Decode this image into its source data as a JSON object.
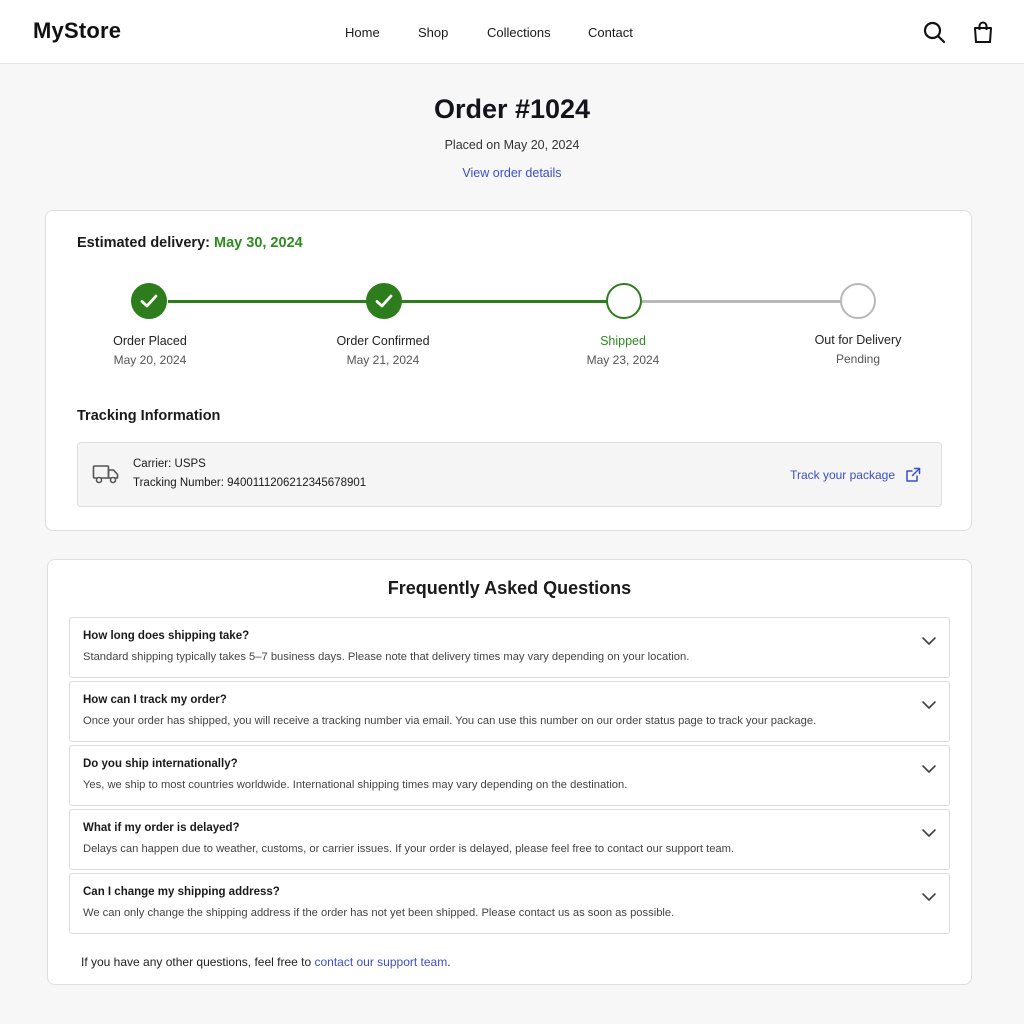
{
  "header": {
    "logo": "MyStore",
    "nav": [
      "Home",
      "Shop",
      "Collections",
      "Contact"
    ],
    "icons": [
      "search-icon",
      "shopping-bag-icon"
    ]
  },
  "order": {
    "title": "Order #1024",
    "placed": "Placed on May 20, 2024",
    "details_link": "View order details"
  },
  "delivery": {
    "label": "Estimated delivery:",
    "date": "May 30, 2024",
    "steps": [
      {
        "label": "Order Placed",
        "date": "May 20, 2024",
        "state": "done"
      },
      {
        "label": "Order Confirmed",
        "date": "May 21, 2024",
        "state": "done"
      },
      {
        "label": "Shipped",
        "date": "May 23, 2024",
        "state": "current"
      },
      {
        "label": "Out for Delivery",
        "date": "Pending",
        "state": "pending"
      }
    ],
    "colors": {
      "complete": "#2e7d1c",
      "pending": "#b8b8b8"
    }
  },
  "tracking": {
    "title": "Tracking Information",
    "carrier": "Carrier: USPS",
    "number": "Tracking Number: 9400111206212345678901",
    "link": "Track your package"
  },
  "faq": {
    "title": "Frequently Asked Questions",
    "items": [
      {
        "q": "How long does shipping take?",
        "a": "Standard shipping typically takes 5–7  business days. Please note that delivery times may vary depending on your location."
      },
      {
        "q": "How can I track my order?",
        "a": "Once your order has shipped, you will receive a tracking number via email. You can use this number on our order status page to track your package."
      },
      {
        "q": "Do you ship internationally?",
        "a": "Yes, we ship to most countries worldwide. International shipping times may vary depending on the destination."
      },
      {
        "q": "What if my order is delayed?",
        "a": "Delays can happen due to weather, customs, or carrier issues. If your order is delayed, please feel free to contact our support team."
      },
      {
        "q": "Can I change my shipping address?",
        "a": "We can only change the shipping address if the order has not yet been shipped. Please contact us as soon as possible."
      }
    ],
    "footer_text": "If you have any other questions, feel free to ",
    "footer_link": "contact our support team",
    "footer_end": "."
  }
}
